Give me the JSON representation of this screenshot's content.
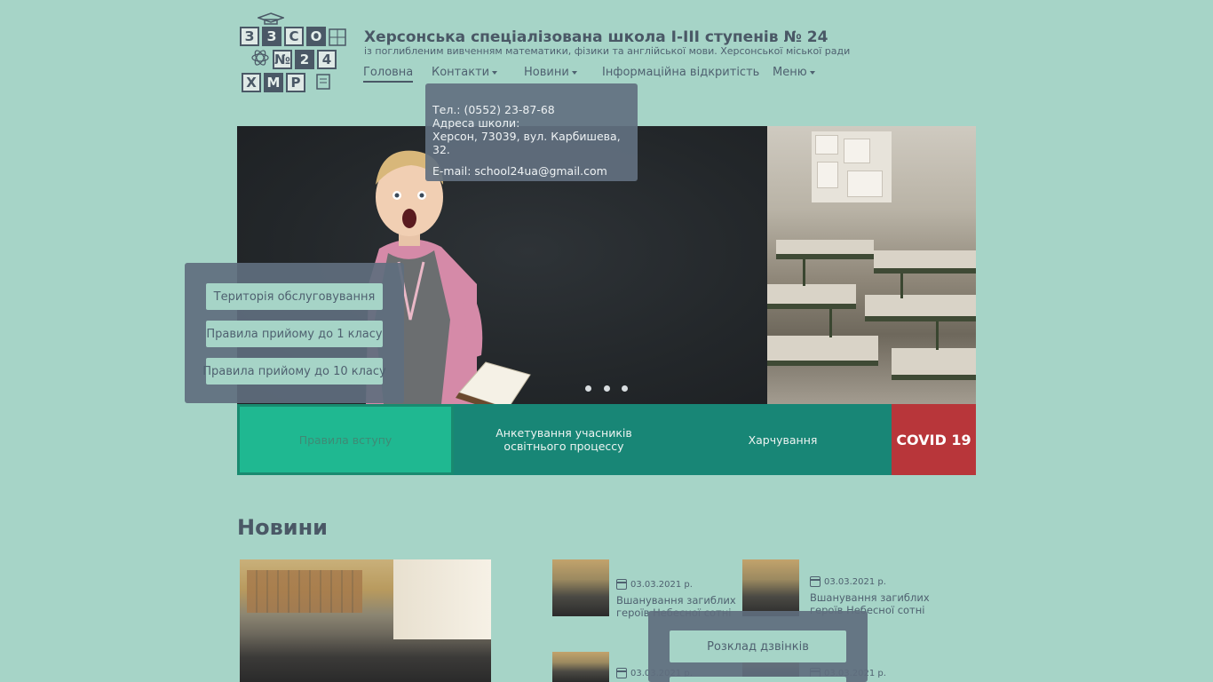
{
  "logo": {
    "tiles": [
      "З",
      "З",
      "С",
      "О",
      "№",
      "2",
      "4",
      "Х",
      "М",
      "Р"
    ]
  },
  "header": {
    "title": "Херсонська спеціалізована школа І-ІІІ ступенів № 24",
    "subtitle": "із поглибленим вивченням математики, фізики та англійської мови. Херсонської міської ради"
  },
  "nav": {
    "items": [
      {
        "label": "Головна",
        "active": true
      },
      {
        "label": "Контакти",
        "dropdown": true
      },
      {
        "label": "Новини",
        "dropdown": true
      },
      {
        "label": "Інформаційна відкритість"
      },
      {
        "label": "Меню",
        "dropdown": true
      }
    ]
  },
  "contacts_dropdown": {
    "phone": "Тел.: (0552) 23-87-68",
    "address_label": "Адреса школи:",
    "address": "Херсон, 73039, вул. Карбишева, 32.",
    "email": "E-mail:  school24ua@gmail.com"
  },
  "side_panel": {
    "buttons": [
      "Територія обслуговування",
      "Правила прийому до 1 класу",
      "Правила прийому до 10 класу"
    ]
  },
  "slider": {
    "slide_count": 3
  },
  "tiles": {
    "t1": "Правила вступу",
    "t2_line1": "Анкетування учасників",
    "t2_line2": "освітнього процессу",
    "t3": "Харчування",
    "t4": "COVID 19"
  },
  "news": {
    "heading": "Новини",
    "items": [
      {
        "date": "03.03.2021 р.",
        "title": "Вшанування загиблих героїв Небесної сотні"
      },
      {
        "date": "03.03.2021 р.",
        "title": "Вшанування загиблих героїв Небесної сотні"
      },
      {
        "date": "03.03.2021 р.",
        "title": ""
      },
      {
        "date": "03.03.2021 р.",
        "title": ""
      }
    ]
  },
  "bell_panel": {
    "button": "Розклад дзвінків"
  },
  "colors": {
    "background": "#a6d4c7",
    "panel": "#606e7e",
    "teal": "#188676",
    "green": "#1fb891",
    "covid_red": "#b8363a"
  }
}
